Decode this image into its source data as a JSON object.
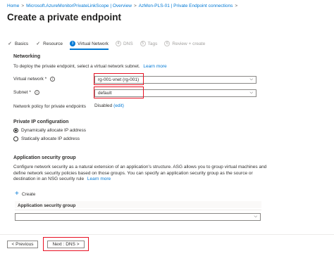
{
  "breadcrumb": [
    "Home",
    "Microsoft.AzureMonitorPrivateLinkScope | Overview",
    "AzMon-PLS-01 | Private Endpoint connections"
  ],
  "breadcrumb_separator": ">",
  "title": "Create a private endpoint",
  "steps": [
    {
      "label": "Basics",
      "mark": "✓",
      "state": "done"
    },
    {
      "label": "Resource",
      "mark": "✓",
      "state": "done"
    },
    {
      "label": "Virtual Network",
      "mark": "3",
      "state": "active"
    },
    {
      "label": "DNS",
      "mark": "4",
      "state": "pending"
    },
    {
      "label": "Tags",
      "mark": "5",
      "state": "pending"
    },
    {
      "label": "Review + create",
      "mark": "6",
      "state": "pending"
    }
  ],
  "networking": {
    "heading": "Networking",
    "description": "To deploy the private endpoint, select a virtual network subnet.",
    "learn_more": "Learn more"
  },
  "fields": {
    "virtual_network_label": "Virtual network *",
    "virtual_network_value": "rg-001-vnet (rg-001)",
    "subnet_label": "Subnet *",
    "subnet_value": "default",
    "policy_label": "Network policy for private endpoints",
    "policy_value": "Disabled",
    "policy_edit": "(edit)"
  },
  "ip_config": {
    "heading": "Private IP configuration",
    "options": [
      "Dynamically allocate IP address",
      "Statically allocate IP address"
    ],
    "selected_index": 0
  },
  "asg": {
    "heading": "Application security group",
    "description_line1": "Configure network security as a natural extension of an application's structure. ASG allows you to group virtual machines and",
    "description_line2": "define network security policies based on those groups. You can specify an application security group as the source or",
    "description_line3": "destination in an NSG security rule",
    "learn_more": "Learn more",
    "create_label": "Create",
    "table_header": "Application security group",
    "select_value": ""
  },
  "footer": {
    "previous_label": "< Previous",
    "next_label": "Next : DNS >"
  },
  "colors": {
    "accent": "#0078d4",
    "highlight": "#e81123",
    "link": "#0078d4"
  },
  "icons": {
    "info": "info-icon",
    "chevron": "chevron-down-icon",
    "plus": "plus-icon",
    "check": "checkmark-icon"
  }
}
